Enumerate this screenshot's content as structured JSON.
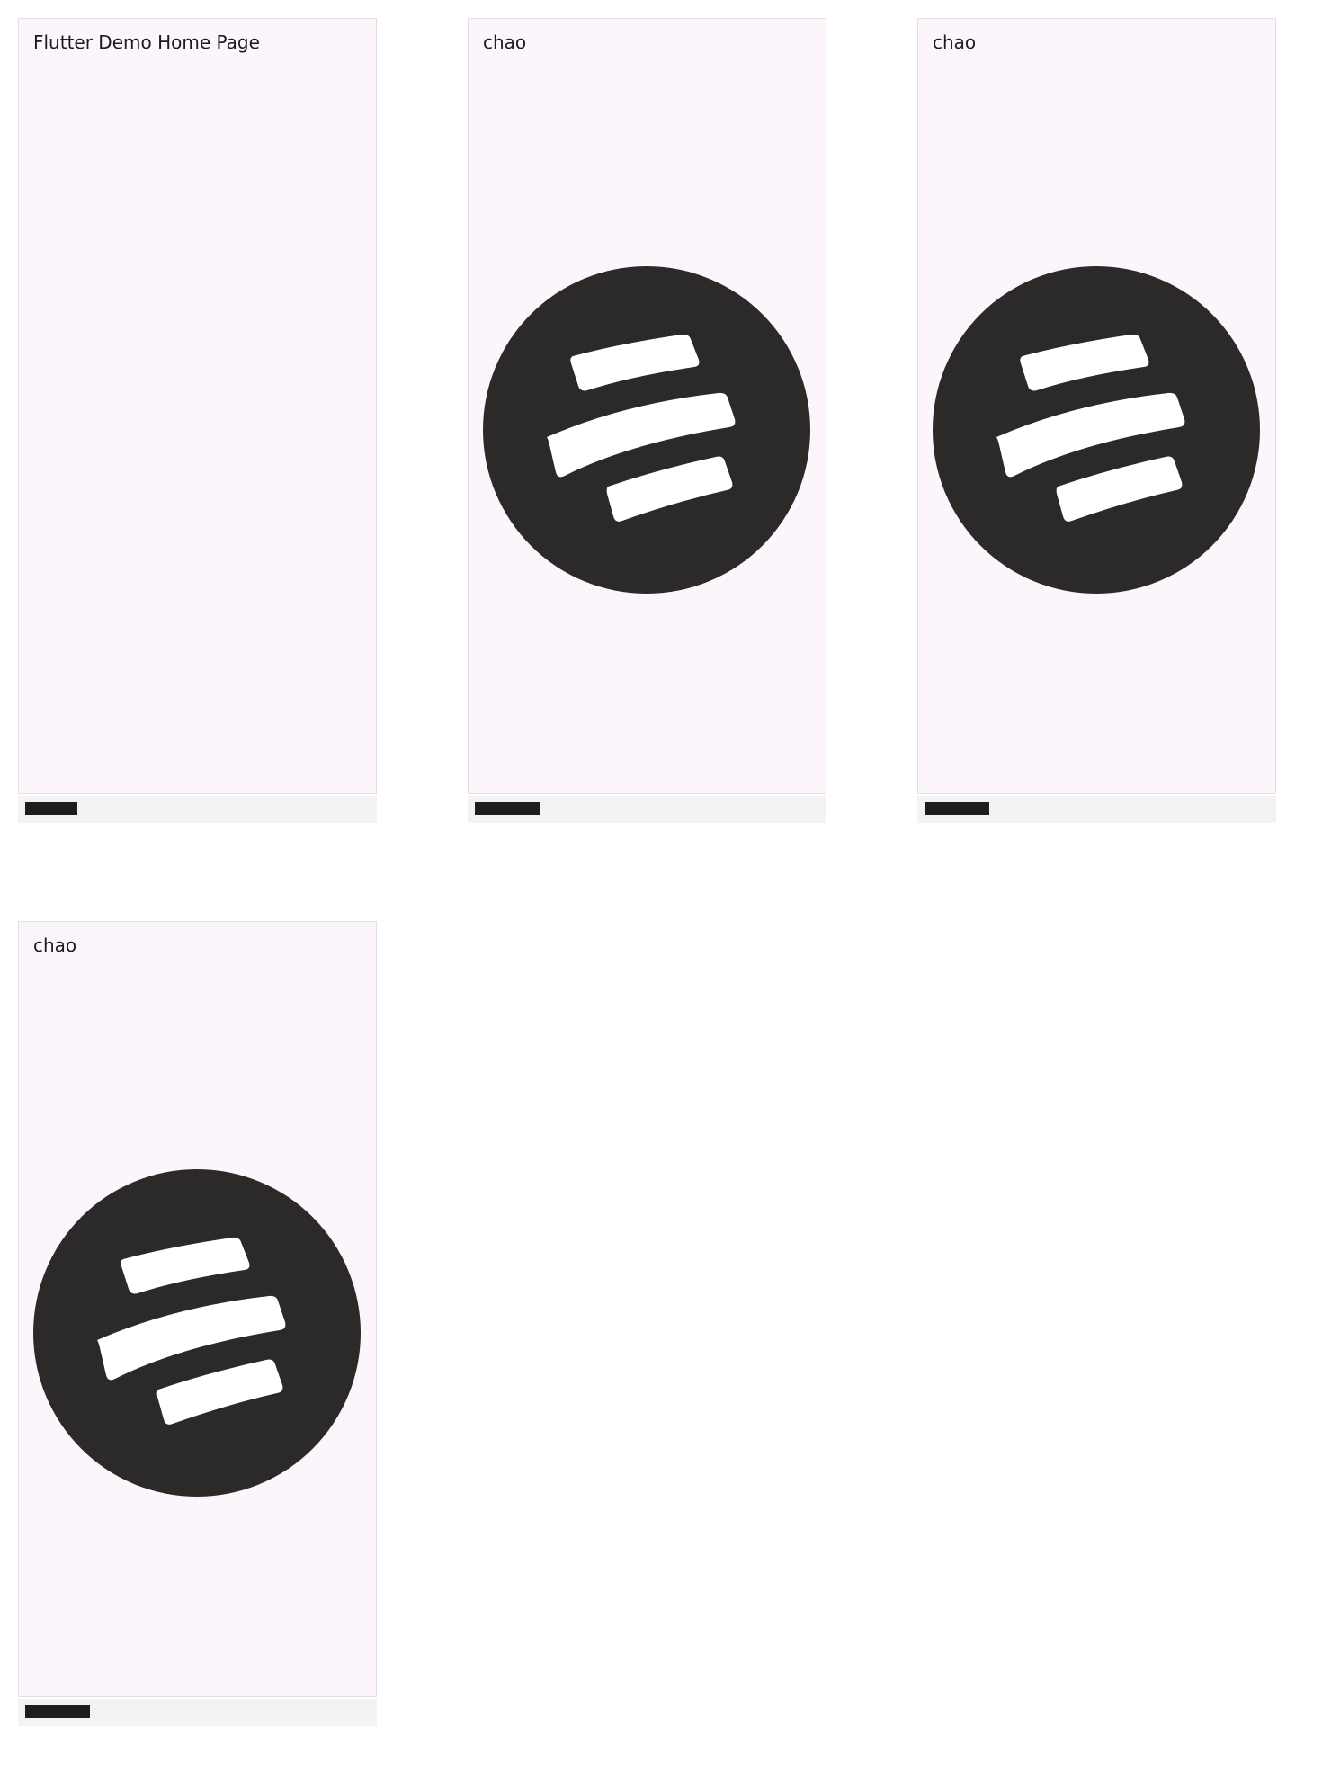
{
  "colors": {
    "screen_background": "#fcf5fc",
    "screen_border": "#e3dee3",
    "title_text": "#1c1b1f",
    "logo_disc": "#2b2a28",
    "logo_bars": "#ffffff",
    "caption_bar": "#f3f3f3",
    "caption_chip": "#1d1d1d"
  },
  "screens": [
    {
      "app_bar_title": "Flutter Demo Home Page",
      "logo_visible": false,
      "logo_icon": "none"
    },
    {
      "app_bar_title": "chao",
      "logo_visible": true,
      "logo_icon": "three-bars-circle-logo-icon"
    },
    {
      "app_bar_title": "chao",
      "logo_visible": true,
      "logo_icon": "three-bars-circle-logo-icon"
    },
    {
      "app_bar_title": "chao",
      "logo_visible": true,
      "logo_icon": "three-bars-circle-logo-icon"
    }
  ]
}
